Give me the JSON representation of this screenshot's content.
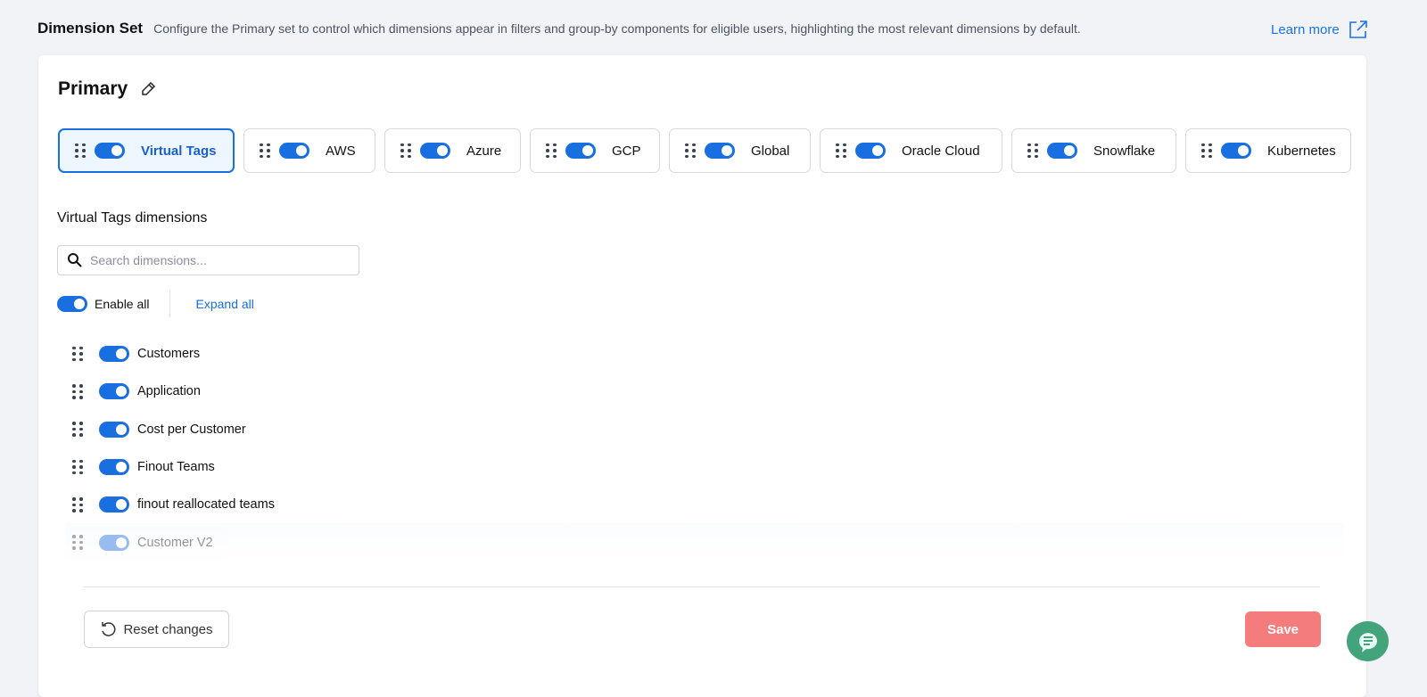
{
  "header": {
    "title": "Dimension Set",
    "description": "Configure the Primary set to control which dimensions appear in filters and group-by components for eligible users, highlighting the most relevant dimensions by default.",
    "learn_more": "Learn more"
  },
  "set": {
    "name": "Primary"
  },
  "tabs": [
    {
      "label": "Virtual Tags",
      "enabled": true,
      "active": true
    },
    {
      "label": "AWS",
      "enabled": true
    },
    {
      "label": "Azure",
      "enabled": true
    },
    {
      "label": "GCP",
      "enabled": true
    },
    {
      "label": "Global",
      "enabled": true
    },
    {
      "label": "Oracle Cloud",
      "enabled": true
    },
    {
      "label": "Snowflake",
      "enabled": true
    },
    {
      "label": "Kubernetes",
      "enabled": true
    }
  ],
  "section": {
    "title": "Virtual Tags dimensions",
    "search_placeholder": "Search dimensions...",
    "enable_all": "Enable all",
    "expand_all": "Expand all"
  },
  "dimensions": [
    {
      "label": "Customers",
      "enabled": true
    },
    {
      "label": "Application",
      "enabled": true
    },
    {
      "label": "Cost per Customer",
      "enabled": true
    },
    {
      "label": "Finout Teams",
      "enabled": true
    },
    {
      "label": "finout reallocated teams",
      "enabled": true
    },
    {
      "label": "Customer V2",
      "enabled": true
    }
  ],
  "footer": {
    "reset": "Reset changes",
    "save": "Save"
  },
  "colors": {
    "accent": "#1a6fe0",
    "save": "#f47c7c",
    "chat": "#43a47b"
  }
}
